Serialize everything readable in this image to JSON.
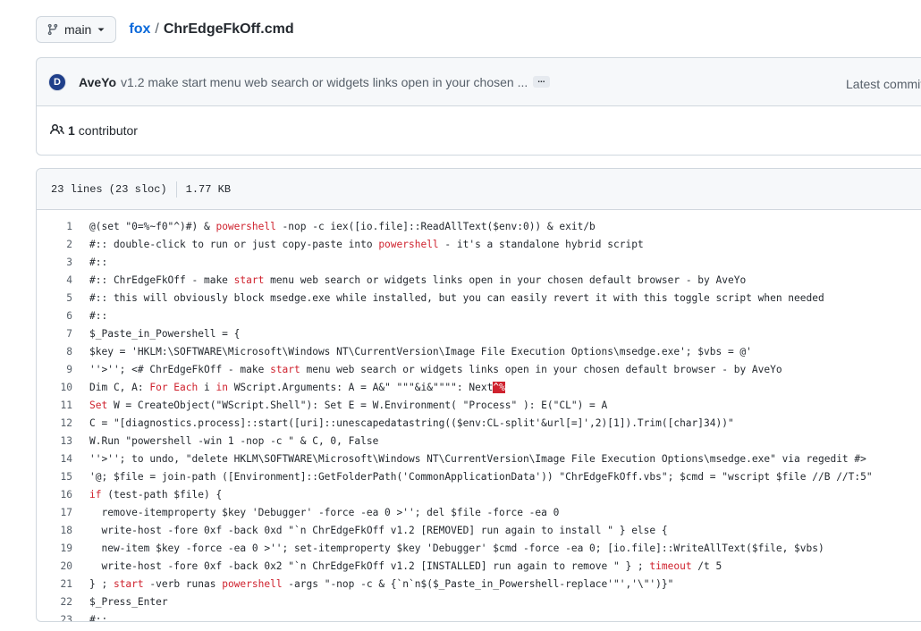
{
  "branch": {
    "name": "main"
  },
  "breadcrumb": {
    "repo": "fox",
    "separator": "/",
    "file": "ChrEdgeFkOff.cmd"
  },
  "commit": {
    "avatar_letter": "D",
    "author": "AveYo",
    "message": "v1.2 make start menu web search or widgets links open in your chosen ...",
    "ellipsis": "...",
    "latest_label": "Latest commit"
  },
  "contributors": {
    "count": "1",
    "label": "contributor"
  },
  "file_info": {
    "lines": "23 lines (23 sloc)",
    "size": "1.77 KB"
  },
  "code": {
    "lines": [
      {
        "n": "1",
        "segments": [
          {
            "t": "@(set \"0=%~f0\"^)#) & "
          },
          {
            "t": "powershell",
            "c": "kw"
          },
          {
            "t": " -nop -c iex([io.file]::ReadAllText($env:0)) & exit/b"
          }
        ]
      },
      {
        "n": "2",
        "segments": [
          {
            "t": "#:: double-click to run or just copy-paste into "
          },
          {
            "t": "powershell",
            "c": "kw"
          },
          {
            "t": " - it's a standalone hybrid script"
          }
        ]
      },
      {
        "n": "3",
        "segments": [
          {
            "t": "#::"
          }
        ]
      },
      {
        "n": "4",
        "segments": [
          {
            "t": "#:: ChrEdgeFkOff - make "
          },
          {
            "t": "start",
            "c": "kw"
          },
          {
            "t": " menu web search or widgets links open in your chosen default browser - by AveYo"
          }
        ]
      },
      {
        "n": "5",
        "segments": [
          {
            "t": "#:: this will obviously block msedge.exe while installed, but you can easily revert it with this toggle script when needed"
          }
        ]
      },
      {
        "n": "6",
        "segments": [
          {
            "t": "#::"
          }
        ]
      },
      {
        "n": "7",
        "segments": [
          {
            "t": "$_Paste_in_Powershell = {"
          }
        ]
      },
      {
        "n": "8",
        "segments": [
          {
            "t": "$key = 'HKLM:\\SOFTWARE\\Microsoft\\Windows NT\\CurrentVersion\\Image File Execution Options\\msedge.exe'; $vbs = @'"
          }
        ]
      },
      {
        "n": "9",
        "segments": [
          {
            "t": "''>''; <# ChrEdgeFkOff - make "
          },
          {
            "t": "start",
            "c": "kw"
          },
          {
            "t": " menu web search or widgets links open in your chosen default browser - by AveYo"
          }
        ]
      },
      {
        "n": "10",
        "segments": [
          {
            "t": "Dim C, A: "
          },
          {
            "t": "For Each",
            "c": "kw"
          },
          {
            "t": " i "
          },
          {
            "t": "in",
            "c": "kw"
          },
          {
            "t": " WScript.Arguments: A = A&\" \"\"\"&i&\"\"\"\": Next"
          },
          {
            "t": "^%",
            "c": "hl"
          }
        ]
      },
      {
        "n": "11",
        "segments": [
          {
            "t": "Set",
            "c": "kw"
          },
          {
            "t": " W = CreateObject(\"WScript.Shell\"): Set E = W.Environment( \"Process\" ): E(\"CL\") = A"
          }
        ]
      },
      {
        "n": "12",
        "segments": [
          {
            "t": "C = \"[diagnostics.process]::start([uri]::unescapedatastring(($env:CL-split'&url[=]',2)[1]).Trim([char]34))\""
          }
        ]
      },
      {
        "n": "13",
        "segments": [
          {
            "t": "W.Run \"powershell -win 1 -nop -c \" & C, 0, False"
          }
        ]
      },
      {
        "n": "14",
        "segments": [
          {
            "t": "''>''; to undo, \"delete HKLM\\SOFTWARE\\Microsoft\\Windows NT\\CurrentVersion\\Image File Execution Options\\msedge.exe\" via regedit #>"
          }
        ]
      },
      {
        "n": "15",
        "segments": [
          {
            "t": "'@; $file = join-path ([Environment]::GetFolderPath('CommonApplicationData')) \"ChrEdgeFkOff.vbs\"; $cmd = \"wscript $file //B //T:5\""
          }
        ]
      },
      {
        "n": "16",
        "segments": [
          {
            "t": "if",
            "c": "kw"
          },
          {
            "t": " (test-path $file) {"
          }
        ]
      },
      {
        "n": "17",
        "segments": [
          {
            "t": "  remove-itemproperty $key 'Debugger' -force -ea 0 >''; del $file -force -ea 0"
          }
        ]
      },
      {
        "n": "18",
        "segments": [
          {
            "t": "  write-host -fore 0xf -back 0xd \"`n ChrEdgeFkOff v1.2 [REMOVED] run again to install \" } else {"
          }
        ]
      },
      {
        "n": "19",
        "segments": [
          {
            "t": "  new-item $key -force -ea 0 >''; set-itemproperty $key 'Debugger' $cmd -force -ea 0; [io.file]::WriteAllText($file, $vbs)"
          }
        ]
      },
      {
        "n": "20",
        "segments": [
          {
            "t": "  write-host -fore 0xf -back 0x2 \"`n ChrEdgeFkOff v1.2 [INSTALLED] run again to remove \" } ; "
          },
          {
            "t": "timeout",
            "c": "kw"
          },
          {
            "t": " /t 5"
          }
        ]
      },
      {
        "n": "21",
        "segments": [
          {
            "t": "} ; "
          },
          {
            "t": "start",
            "c": "kw"
          },
          {
            "t": " -verb runas "
          },
          {
            "t": "powershell",
            "c": "kw"
          },
          {
            "t": " -args \"-nop -c & {`n`n$($_Paste_in_Powershell-replace'\"','\\\"')}\""
          }
        ]
      },
      {
        "n": "22",
        "segments": [
          {
            "t": "$_Press_Enter"
          }
        ]
      },
      {
        "n": "23",
        "segments": [
          {
            "t": "#::"
          }
        ]
      }
    ]
  }
}
